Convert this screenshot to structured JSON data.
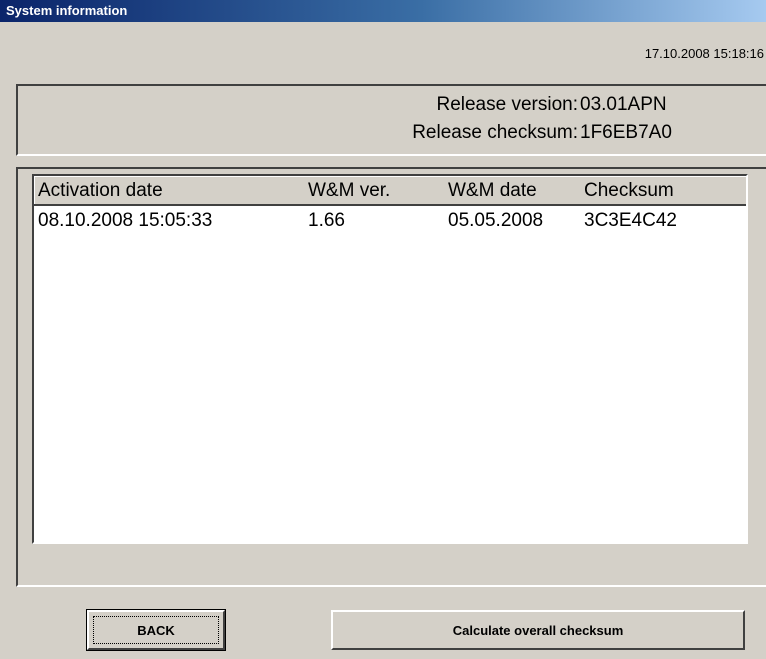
{
  "window": {
    "title": "System information"
  },
  "timestamp": "17.10.2008 15:18:16",
  "release": {
    "version_label": "Release version:",
    "version_value": "03.01APN",
    "checksum_label": "Release checksum:",
    "checksum_value": "1F6EB7A0"
  },
  "table": {
    "columns": [
      "Activation date",
      "W&M ver.",
      "W&M date",
      "Checksum"
    ],
    "rows": [
      [
        "08.10.2008 15:05:33",
        "1.66",
        "05.05.2008",
        "3C3E4C42"
      ]
    ]
  },
  "buttons": {
    "back": "BACK",
    "calculate": "Calculate overall checksum"
  }
}
